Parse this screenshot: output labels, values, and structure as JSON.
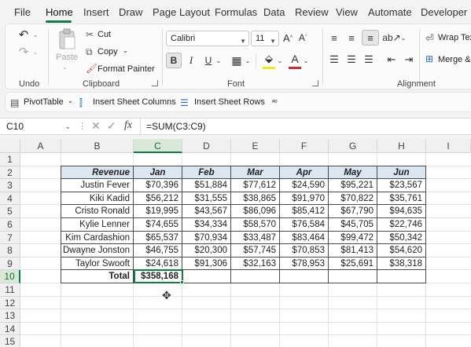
{
  "menu": [
    "File",
    "Home",
    "Insert",
    "Draw",
    "Page Layout",
    "Formulas",
    "Data",
    "Review",
    "View",
    "Automate",
    "Developer"
  ],
  "ribbon": {
    "undo_label": "Undo",
    "paste_label": "Paste",
    "cut_label": "Cut",
    "copy_label": "Copy",
    "format_painter_label": "Format Painter",
    "clipboard_label": "Clipboard",
    "font_name": "Calibri",
    "font_size": "11",
    "font_label": "Font",
    "bold": "B",
    "italic": "I",
    "underline": "U",
    "alignment_label": "Alignment",
    "wrap_text": "Wrap Tex",
    "merge": "Merge &"
  },
  "quick_access": {
    "pivot": "PivotTable",
    "insert_cols": "Insert Sheet Columns",
    "insert_rows": "Insert Sheet Rows"
  },
  "formula_bar": {
    "name_box": "C10",
    "fx": "fx",
    "formula": "=SUM(C3:C9)"
  },
  "columns": [
    "A",
    "B",
    "C",
    "D",
    "E",
    "F",
    "G",
    "H",
    "I"
  ],
  "rows": [
    "1",
    "2",
    "3",
    "4",
    "5",
    "6",
    "7",
    "8",
    "9",
    "10",
    "11",
    "12",
    "13",
    "14",
    "15"
  ],
  "table": {
    "header": [
      "Revenue",
      "Jan",
      "Feb",
      "Mar",
      "Apr",
      "May",
      "Jun"
    ],
    "rows": [
      [
        "Justin Fever",
        "$70,396",
        "$51,884",
        "$77,612",
        "$24,590",
        "$95,221",
        "$23,567"
      ],
      [
        "Kiki Kadid",
        "$56,212",
        "$31,555",
        "$38,865",
        "$91,970",
        "$70,822",
        "$35,761"
      ],
      [
        "Cristo Ronald",
        "$19,995",
        "$43,567",
        "$86,096",
        "$85,412",
        "$67,790",
        "$94,635"
      ],
      [
        "Kylie Lenner",
        "$74,655",
        "$34,334",
        "$58,570",
        "$76,584",
        "$45,705",
        "$22,746"
      ],
      [
        "Kim Cardashion",
        "$65,537",
        "$70,934",
        "$33,487",
        "$83,464",
        "$99,472",
        "$50,342"
      ],
      [
        "Dwayne Jonston",
        "$46,755",
        "$20,300",
        "$57,745",
        "$70,853",
        "$81,413",
        "$54,620"
      ],
      [
        "Taylor Swooft",
        "$24,618",
        "$91,306",
        "$32,163",
        "$78,953",
        "$25,691",
        "$38,318"
      ]
    ],
    "total_label": "Total",
    "total_value": "$358,168"
  },
  "colors": {
    "accent": "#107c41",
    "header_fill": "#dce6f1"
  }
}
